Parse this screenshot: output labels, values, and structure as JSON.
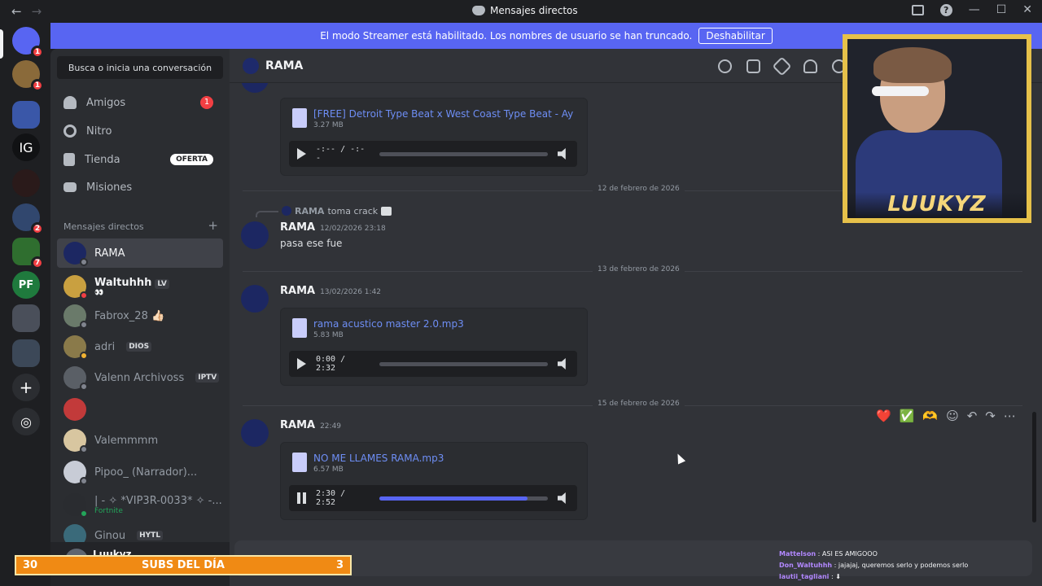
{
  "titlebar": {
    "title": "Mensajes directos",
    "back": "←",
    "forward": "→",
    "min": "—",
    "max": "☐",
    "close": "✕"
  },
  "streamer": {
    "text": "El modo Streamer está habilitado. Los nombres de usuario se han truncado.",
    "button": "Deshabilitar"
  },
  "guilds": [
    {
      "label": "",
      "badge": "1"
    },
    {
      "label": "",
      "badge": "1"
    },
    {
      "label": "",
      "badge": ""
    },
    {
      "label": "IG",
      "badge": ""
    },
    {
      "label": "",
      "badge": ""
    },
    {
      "label": "",
      "badge": "2"
    },
    {
      "label": "",
      "badge": "7"
    },
    {
      "label": "PF",
      "badge": ""
    },
    {
      "label": "",
      "badge": ""
    },
    {
      "label": "",
      "badge": ""
    },
    {
      "label": "+",
      "badge": ""
    },
    {
      "label": "◎",
      "badge": ""
    }
  ],
  "sidebar": {
    "search": "Busca o inicia una conversación",
    "nav": [
      {
        "label": "Amigos",
        "count": "1"
      },
      {
        "label": "Nitro"
      },
      {
        "label": "Tienda",
        "tag": "OFERTA"
      },
      {
        "label": "Misiones"
      }
    ],
    "dm_header": "Mensajes directos",
    "dm_add": "+",
    "dms": [
      {
        "name": "RAMA"
      },
      {
        "name": "Waltuhhh",
        "tag": "LV",
        "sub": "👀"
      },
      {
        "name": "Fabrox_28 👍🏻"
      },
      {
        "name": "adri",
        "tag": "DIOS"
      },
      {
        "name": "Valenn Archivoss",
        "tag": "IPTV"
      },
      {
        "name": ""
      },
      {
        "name": "Valemmmm"
      },
      {
        "name": "Pipoo_ (Narrador)..."
      },
      {
        "name": "| - ✧ *VIP3R-0033* ✧ -...",
        "sub": "Fortnite"
      },
      {
        "name": "Ginou",
        "tag": "HYTL"
      }
    ],
    "user": "Luukyz"
  },
  "channel": {
    "name": "RAMA"
  },
  "messages": {
    "attach1": {
      "name": "[FREE] Detroit Type Beat x West Coast Type Beat - Ay F",
      "size": "3.27 MB",
      "time": "-:-- / -:--"
    },
    "date1": "12 de febrero de 2026",
    "reply": {
      "name": "RAMA",
      "text": "toma crack"
    },
    "msg1": {
      "author": "RAMA",
      "time": "12/02/2026 23:18",
      "text": "pasa ese fue"
    },
    "date2": "13 de febrero de 2026",
    "msg2": {
      "author": "RAMA",
      "time": "13/02/2026 1:42"
    },
    "attach2": {
      "name": "rama acustico master 2.0.mp3",
      "size": "5.83 MB",
      "time": "0:00 / 2:32",
      "progress": 0
    },
    "date3": "15 de febrero de 2026",
    "msg3": {
      "author": "RAMA",
      "time": "22:49"
    },
    "attach3": {
      "name": "NO ME LLAMES RAMA.mp3",
      "size": "6.57 MB",
      "time": "2:30 / 2:52",
      "progress": 0.88
    }
  },
  "actions": [
    "❤️",
    "✅",
    "🫶",
    "☺",
    "↶",
    "↷",
    "⋯"
  ],
  "overlay": {
    "cam_label": "LUUKYZ",
    "subs_left": "30",
    "subs_title": "SUBS DEL DÍA",
    "subs_right": "3"
  },
  "chat": [
    {
      "user": "Mattelson",
      "text": "ASI ES AMIGOOO"
    },
    {
      "user": "Don_Waltuhhh",
      "text": "jajajaj, queremos serlo y podemos serlo"
    },
    {
      "user": "lautii_tagliani",
      "text": "⬇"
    }
  ]
}
